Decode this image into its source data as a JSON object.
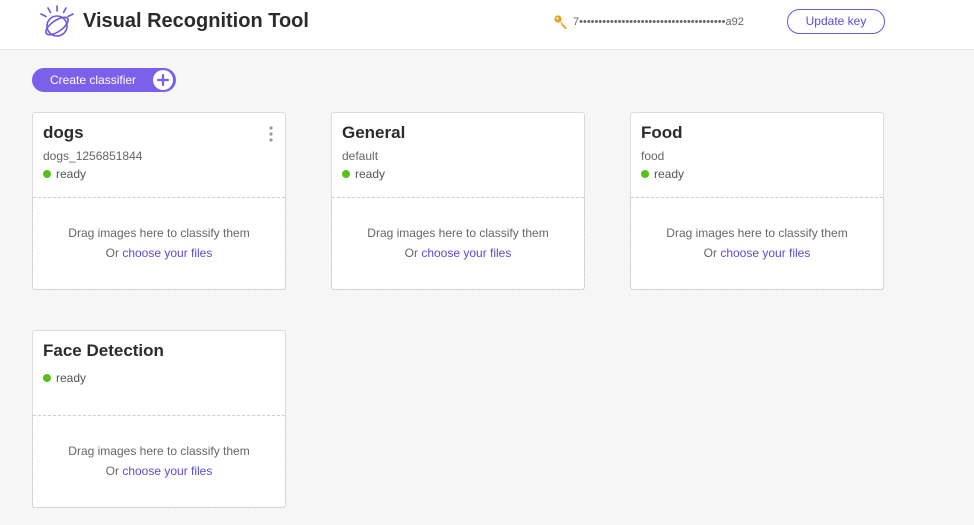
{
  "header": {
    "title": "Visual Recognition Tool",
    "api_key_masked": "7••••••••••••••••••••••••••••••••••••••a92",
    "update_key_label": "Update key"
  },
  "toolbar": {
    "create_classifier_label": "Create classifier"
  },
  "classifiers": [
    {
      "name": "dogs",
      "id": "dogs_1256851844",
      "status": "ready",
      "has_menu": true,
      "drop_text": "Drag images here to classify them",
      "drop_prefix": "Or",
      "drop_link": "choose your files"
    },
    {
      "name": "General",
      "id": "default",
      "status": "ready",
      "has_menu": false,
      "drop_text": "Drag images here to classify them",
      "drop_prefix": "Or",
      "drop_link": "choose your files"
    },
    {
      "name": "Food",
      "id": "food",
      "status": "ready",
      "has_menu": false,
      "drop_text": "Drag images here to classify them",
      "drop_prefix": "Or",
      "drop_link": "choose your files"
    },
    {
      "name": "Face Detection",
      "id": "",
      "status": "ready",
      "has_menu": false,
      "drop_text": "Drag images here to classify them",
      "drop_prefix": "Or",
      "drop_link": "choose your files"
    }
  ],
  "icons": {
    "logo": "ibm-watson-logo-icon",
    "key": "key-icon",
    "plus": "plus-circle-icon",
    "menu": "vertical-ellipsis-icon"
  },
  "colors": {
    "accent": "#7b61ea",
    "link": "#5b4bd5",
    "status_ready": "#55c11a"
  }
}
